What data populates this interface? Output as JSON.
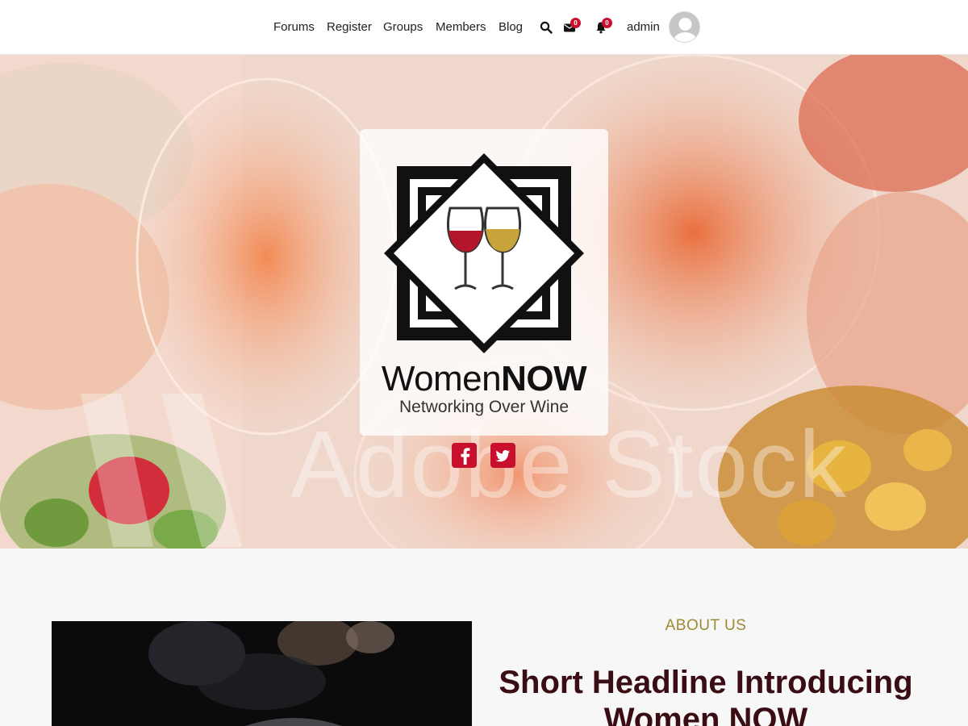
{
  "nav": {
    "links": [
      "Forums",
      "Register",
      "Groups",
      "Members",
      "Blog"
    ],
    "icons": [
      "search-icon",
      "envelope-icon",
      "bell-icon"
    ],
    "messages_count": "0",
    "notifications_count": "0",
    "username": "admin"
  },
  "hero": {
    "watermark": "Adobe Stock",
    "brand_light": "Women",
    "brand_bold": "NOW",
    "tagline": "Networking Over Wine",
    "social_icons": [
      "facebook-icon",
      "twitter-icon"
    ]
  },
  "about": {
    "eyebrow": "ABOUT US",
    "headline": "Short Headline Introducing Women NOW"
  },
  "colors": {
    "accent": "#c8102e",
    "gold": "#9c8a34",
    "headline": "#3a0d14"
  }
}
